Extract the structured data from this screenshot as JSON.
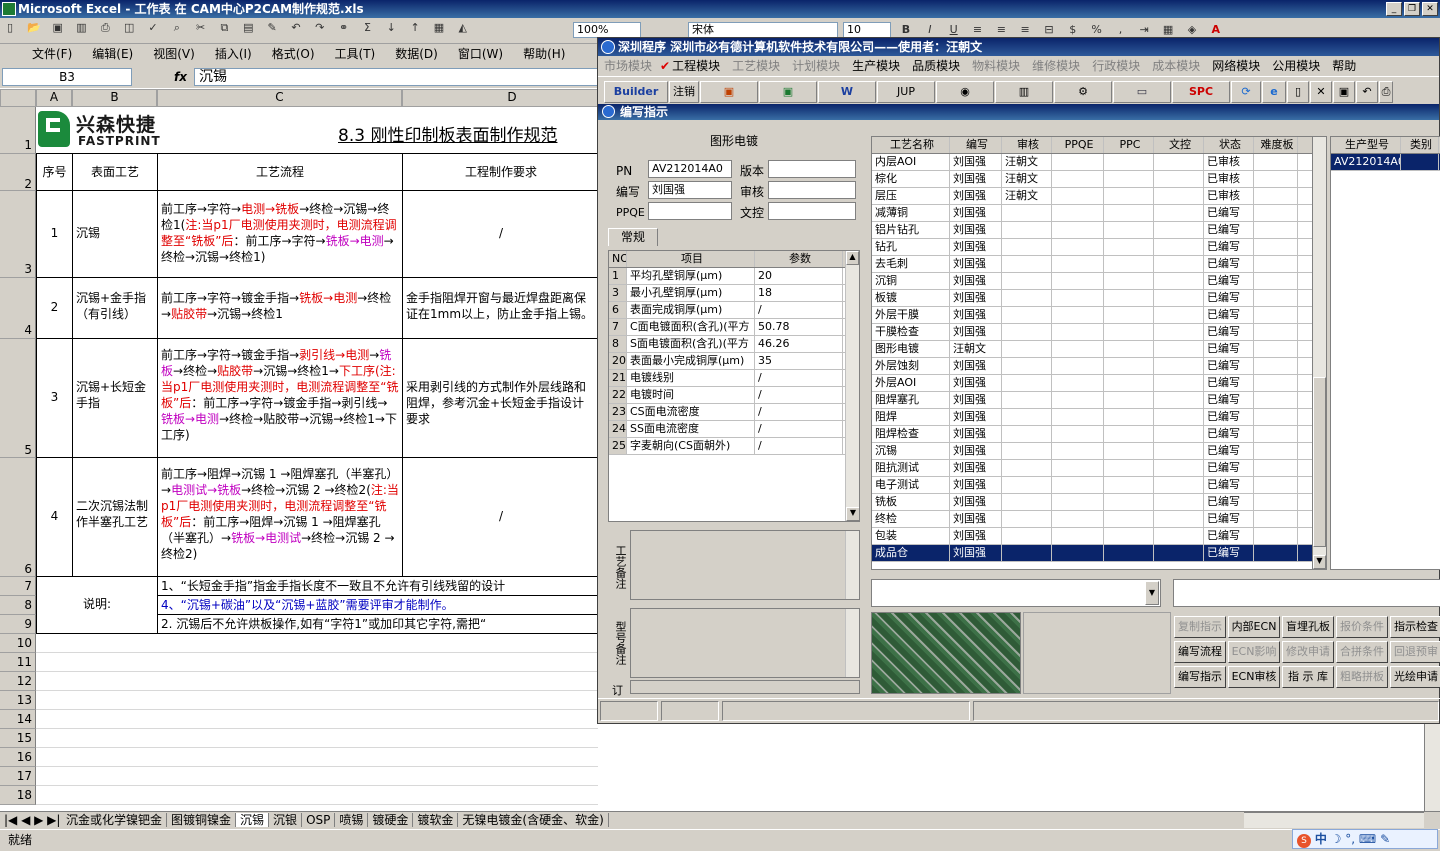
{
  "excel": {
    "title": "Microsoft Excel - 工作表 在 CAM中心P2CAM制作规范.xls",
    "menu": [
      "文件(F)",
      "编辑(E)",
      "视图(V)",
      "插入(I)",
      "格式(O)",
      "工具(T)",
      "数据(D)",
      "窗口(W)",
      "帮助(H)"
    ],
    "zoom": "100%",
    "font_name": "宋体",
    "font_size": "10",
    "name_box": "B3",
    "fx_symbol": "fx",
    "formula": "沉锡",
    "columns": [
      "A",
      "B",
      "C",
      "D"
    ],
    "logo_cn": "兴森快捷",
    "logo_en": "FASTPRINT",
    "sheet_title": "8.3 刚性印制板表面制作规范",
    "headers": [
      "序号",
      "表面工艺",
      "工艺流程",
      "工程制作要求"
    ],
    "rows": [
      {
        "no": "1",
        "surface": "沉锡",
        "flow": [
          {
            "t": "前工序→字符→",
            "c": ""
          },
          {
            "t": "电测→铣板",
            "c": "red"
          },
          {
            "t": "→终检→沉锡→终检1(",
            "c": ""
          },
          {
            "t": "注:当p1厂电测使用夹测时，电测流程调整至“铣板”后",
            "c": "red"
          },
          {
            "t": "：前工序→字符→",
            "c": ""
          },
          {
            "t": "铣板→电测",
            "c": "mag"
          },
          {
            "t": "→终检→沉锡→终检1)",
            "c": ""
          }
        ],
        "req": "/"
      },
      {
        "no": "2",
        "surface": "沉锡+金手指（有引线）",
        "flow": [
          {
            "t": "前工序→字符→镀金手指→",
            "c": ""
          },
          {
            "t": "铣板→电测",
            "c": "red"
          },
          {
            "t": "→终检→",
            "c": ""
          },
          {
            "t": "贴胶带",
            "c": "red"
          },
          {
            "t": "→沉锡→终检1",
            "c": ""
          }
        ],
        "req": "金手指阻焊开窗与最近焊盘距离保证在1mm以上，防止金手指上锡。"
      },
      {
        "no": "3",
        "surface": "沉锡+长短金手指",
        "flow": [
          {
            "t": "前工序→字符→镀金手指→",
            "c": ""
          },
          {
            "t": "剥引线→电测",
            "c": "red"
          },
          {
            "t": "→",
            "c": ""
          },
          {
            "t": "铣板",
            "c": "mag"
          },
          {
            "t": "→终检→",
            "c": ""
          },
          {
            "t": "贴胶带",
            "c": "red"
          },
          {
            "t": "→沉锡→终检1→",
            "c": ""
          },
          {
            "t": "下工序(注:当p1厂电测使用夹测时，电测流程调整至“铣板”后",
            "c": "red"
          },
          {
            "t": "：前工序→字符→镀金手指→剥引线→",
            "c": ""
          },
          {
            "t": "铣板→电测",
            "c": "mag"
          },
          {
            "t": "→终检→贴胶带→沉锡→终检1→下工序)",
            "c": ""
          }
        ],
        "req": "采用剥引线的方式制作外层线路和阻焊，参考沉金+长短金手指设计要求"
      },
      {
        "no": "4",
        "surface": "二次沉锡法制作半塞孔工艺",
        "flow": [
          {
            "t": "前工序→阻焊→沉锡 1 →阻焊塞孔（半塞孔）→",
            "c": ""
          },
          {
            "t": "电测试→铣板",
            "c": "mag"
          },
          {
            "t": "→终检→沉锡 2 →终检2(",
            "c": ""
          },
          {
            "t": "注:当p1厂电测使用夹测时，电测流程调整至“铣板”后",
            "c": "red"
          },
          {
            "t": "：前工序→阻焊→沉锡 1 →阻焊塞孔（半塞孔）→",
            "c": ""
          },
          {
            "t": "铣板→电测试",
            "c": "mag"
          },
          {
            "t": "→终检→沉锡 2 →终检2)",
            "c": ""
          }
        ],
        "req": "/"
      }
    ],
    "note_label": "说明:",
    "notes": [
      {
        "t": "1、“长短金手指”指金手指长度不一致且不允许有引线残留的设计",
        "c": ""
      },
      {
        "t": "4、“沉锡+碳油”以及“沉锡+蓝胶”需要评审才能制作。",
        "c": "blue"
      },
      {
        "t": "2. 沉锡后不允许烘板操作,如有“字符1”或加印其它字符,需把“",
        "c": ""
      }
    ],
    "row_numbers": [
      "1",
      "2",
      "3",
      "4",
      "5",
      "6",
      "7",
      "8",
      "9",
      "10",
      "11",
      "12",
      "13",
      "14",
      "15",
      "16",
      "17",
      "18"
    ],
    "sheet_tabs": [
      "沉金或化学镍钯金",
      "图镀铜镍金",
      "沉锡",
      "沉银",
      "OSP",
      "喷锡",
      "镀硬金",
      "镀软金",
      "无镍电镀金(含硬金、软金)"
    ],
    "active_tab": "沉锡",
    "status": "就绪"
  },
  "app": {
    "title": "深圳程序    深圳市必有德计算机软件技术有限公司——使用者：汪朝文",
    "menu": [
      {
        "label": "市场模块",
        "dim": true
      },
      {
        "label": "工程模块",
        "dim": false
      },
      {
        "label": "工艺模块",
        "dim": true
      },
      {
        "label": "计划模块",
        "dim": true
      },
      {
        "label": "生产模块",
        "dim": false
      },
      {
        "label": "品质模块",
        "dim": false
      },
      {
        "label": "物料模块",
        "dim": true
      },
      {
        "label": "维修模块",
        "dim": true
      },
      {
        "label": "行政模块",
        "dim": true
      },
      {
        "label": "成本模块",
        "dim": true
      },
      {
        "label": "网络模块",
        "dim": false
      },
      {
        "label": "公用模块",
        "dim": false
      },
      {
        "label": "帮助",
        "dim": false
      }
    ],
    "toolbar": {
      "builder": "Builder",
      "logout": "注销",
      "jup": "JUP",
      "spc": "SPC"
    },
    "sub_title": "编写指示",
    "form": {
      "section": "图形电镀",
      "pn_label": "PN",
      "pn": "AV212014A0",
      "version_label": "版本",
      "version": "",
      "writer_label": "编写",
      "writer": "刘国强",
      "reviewer_label": "审核",
      "reviewer": "",
      "ppqe_label": "PPQE",
      "ppqe": "",
      "doc_label": "文控",
      "doc": "",
      "tab": "常规"
    },
    "param_headers": [
      "NO",
      "项目",
      "参数"
    ],
    "params": [
      {
        "no": "1",
        "item": "平均孔壁铜厚(μm)",
        "val": "20"
      },
      {
        "no": "3",
        "item": "最小孔壁铜厚(μm)",
        "val": "18"
      },
      {
        "no": "6",
        "item": "表面完成铜厚(μm)",
        "val": "/"
      },
      {
        "no": "7",
        "item": "C面电镀面积(含孔)(平方",
        "val": "50.78"
      },
      {
        "no": "8",
        "item": "S面电镀面积(含孔)(平方",
        "val": "46.26"
      },
      {
        "no": "20",
        "item": "表面最小完成铜厚(μm)",
        "val": "35"
      },
      {
        "no": "21",
        "item": "电镀线别",
        "val": "/"
      },
      {
        "no": "22",
        "item": "电镀时间",
        "val": "/"
      },
      {
        "no": "23",
        "item": "CS面电流密度",
        "val": "/"
      },
      {
        "no": "24",
        "item": "SS面电流密度",
        "val": "/"
      },
      {
        "no": "25",
        "item": "字麦朝向(CS面朝外)",
        "val": "/"
      }
    ],
    "note1_label": "工艺备注",
    "note2_label": "型号备注",
    "note3_label": "订",
    "proc_headers": [
      "工艺名称",
      "编写",
      "审核",
      "PPQE",
      "PPC",
      "文控",
      "状态",
      "难度板"
    ],
    "processes": [
      {
        "name": "内层AOI",
        "w": "刘国强",
        "r": "汪朝文",
        "s": "已审核"
      },
      {
        "name": "棕化",
        "w": "刘国强",
        "r": "汪朝文",
        "s": "已审核"
      },
      {
        "name": "层压",
        "w": "刘国强",
        "r": "汪朝文",
        "s": "已审核"
      },
      {
        "name": "减薄铜",
        "w": "刘国强",
        "r": "",
        "s": "已编写"
      },
      {
        "name": "铝片钻孔",
        "w": "刘国强",
        "r": "",
        "s": "已编写"
      },
      {
        "name": "钻孔",
        "w": "刘国强",
        "r": "",
        "s": "已编写"
      },
      {
        "name": "去毛刺",
        "w": "刘国强",
        "r": "",
        "s": "已编写"
      },
      {
        "name": "沉铜",
        "w": "刘国强",
        "r": "",
        "s": "已编写"
      },
      {
        "name": "板镀",
        "w": "刘国强",
        "r": "",
        "s": "已编写"
      },
      {
        "name": "外层干膜",
        "w": "刘国强",
        "r": "",
        "s": "已编写"
      },
      {
        "name": "干膜检查",
        "w": "刘国强",
        "r": "",
        "s": "已编写"
      },
      {
        "name": "图形电镀",
        "w": "汪朝文",
        "r": "",
        "s": "已编写"
      },
      {
        "name": "外层蚀刻",
        "w": "刘国强",
        "r": "",
        "s": "已编写"
      },
      {
        "name": "外层AOI",
        "w": "刘国强",
        "r": "",
        "s": "已编写"
      },
      {
        "name": "阻焊塞孔",
        "w": "刘国强",
        "r": "",
        "s": "已编写"
      },
      {
        "name": "阻焊",
        "w": "刘国强",
        "r": "",
        "s": "已编写"
      },
      {
        "name": "阻焊检查",
        "w": "刘国强",
        "r": "",
        "s": "已编写"
      },
      {
        "name": "沉锡",
        "w": "刘国强",
        "r": "",
        "s": "已编写"
      },
      {
        "name": "阻抗测试",
        "w": "刘国强",
        "r": "",
        "s": "已编写"
      },
      {
        "name": "电子测试",
        "w": "刘国强",
        "r": "",
        "s": "已编写"
      },
      {
        "name": "铣板",
        "w": "刘国强",
        "r": "",
        "s": "已编写"
      },
      {
        "name": "终检",
        "w": "刘国强",
        "r": "",
        "s": "已编写"
      },
      {
        "name": "包装",
        "w": "刘国强",
        "r": "",
        "s": "已编写"
      },
      {
        "name": "成品仓",
        "w": "刘国强",
        "r": "",
        "s": "已编写"
      }
    ],
    "model_headers": [
      "生产型号",
      "类别"
    ],
    "model": "AV212014A0",
    "buttons": [
      {
        "label": "复制指示",
        "dis": true
      },
      {
        "label": "内部ECN",
        "dis": false
      },
      {
        "label": "盲埋孔板",
        "dis": false
      },
      {
        "label": "报价条件",
        "dis": true
      },
      {
        "label": "指示检查",
        "dis": false
      },
      {
        "label": "编写流程",
        "dis": false
      },
      {
        "label": "ECN影响",
        "dis": true
      },
      {
        "label": "修改申请",
        "dis": true
      },
      {
        "label": "合拼条件",
        "dis": true
      },
      {
        "label": "回退预审",
        "dis": true
      },
      {
        "label": "编写指示",
        "dis": false
      },
      {
        "label": "ECN审核",
        "dis": false
      },
      {
        "label": "指 示 库",
        "dis": false
      },
      {
        "label": "粗略拼板",
        "dis": true
      },
      {
        "label": "光绘申请",
        "dis": false
      }
    ]
  },
  "ime": {
    "label": "中"
  }
}
